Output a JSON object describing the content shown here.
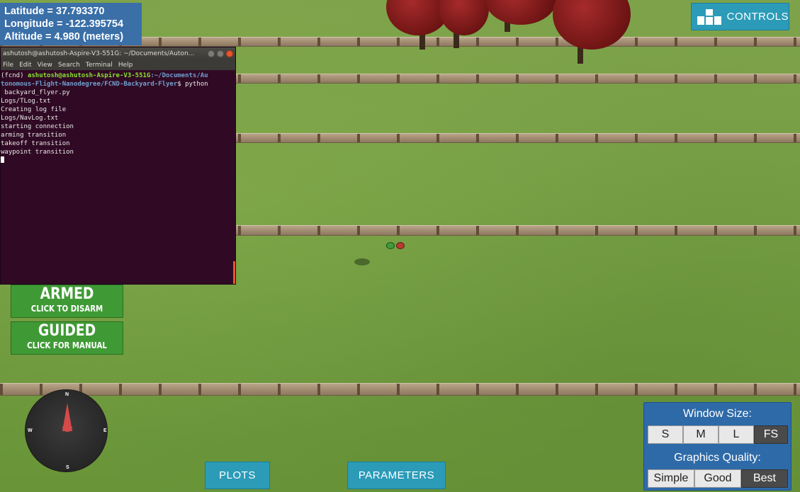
{
  "gps": {
    "latitude": "Latitude = 37.793370",
    "longitude": "Longitude = -122.395754",
    "altitude": "Altitude = 4.980 (meters)"
  },
  "controls_button": {
    "label": "CONTROLS",
    "icon": "grid-icon"
  },
  "terminal": {
    "title": "ashutosh@ashutosh-Aspire-V3-551G: ~/Documents/Auton...",
    "menu": [
      "File",
      "Edit",
      "View",
      "Search",
      "Terminal",
      "Help"
    ],
    "prompt_env": "(fcnd) ",
    "prompt_user": "ashutosh@ashutosh-Aspire-V3-551G",
    "prompt_path_1": ":~/Documents/Au",
    "prompt_path_2": "tonomous-Flight-Nanodegree/FCND-Backyard-Flyer",
    "prompt_cmd": "$ python",
    "lines": [
      " backyard_flyer.py",
      "Logs/TLog.txt",
      "Creating log file",
      "Logs/NavLog.txt",
      "starting connection",
      "arming transition",
      "takeoff transition",
      "waypoint transition"
    ]
  },
  "armed_button": {
    "title": "ARMED",
    "subtitle": "CLICK TO DISARM"
  },
  "guided_button": {
    "title": "GUIDED",
    "subtitle": "CLICK FOR MANUAL"
  },
  "compass": {
    "n": "N",
    "e": "E",
    "s": "S",
    "w": "W"
  },
  "bottom": {
    "plots": "PLOTS",
    "parameters": "PARAMETERS"
  },
  "window_panel": {
    "size_title": "Window Size:",
    "sizes": [
      "S",
      "M",
      "L",
      "FS"
    ],
    "selected_size": "FS",
    "quality_title": "Graphics Quality:",
    "qualities": [
      "Simple",
      "Good",
      "Best"
    ],
    "selected_quality": "Best"
  },
  "colors": {
    "accent": "#2b9bb8",
    "armed_green": "#3f9a35",
    "gps_blue": "#3a6fa8",
    "terminal_bg": "#300a24"
  }
}
